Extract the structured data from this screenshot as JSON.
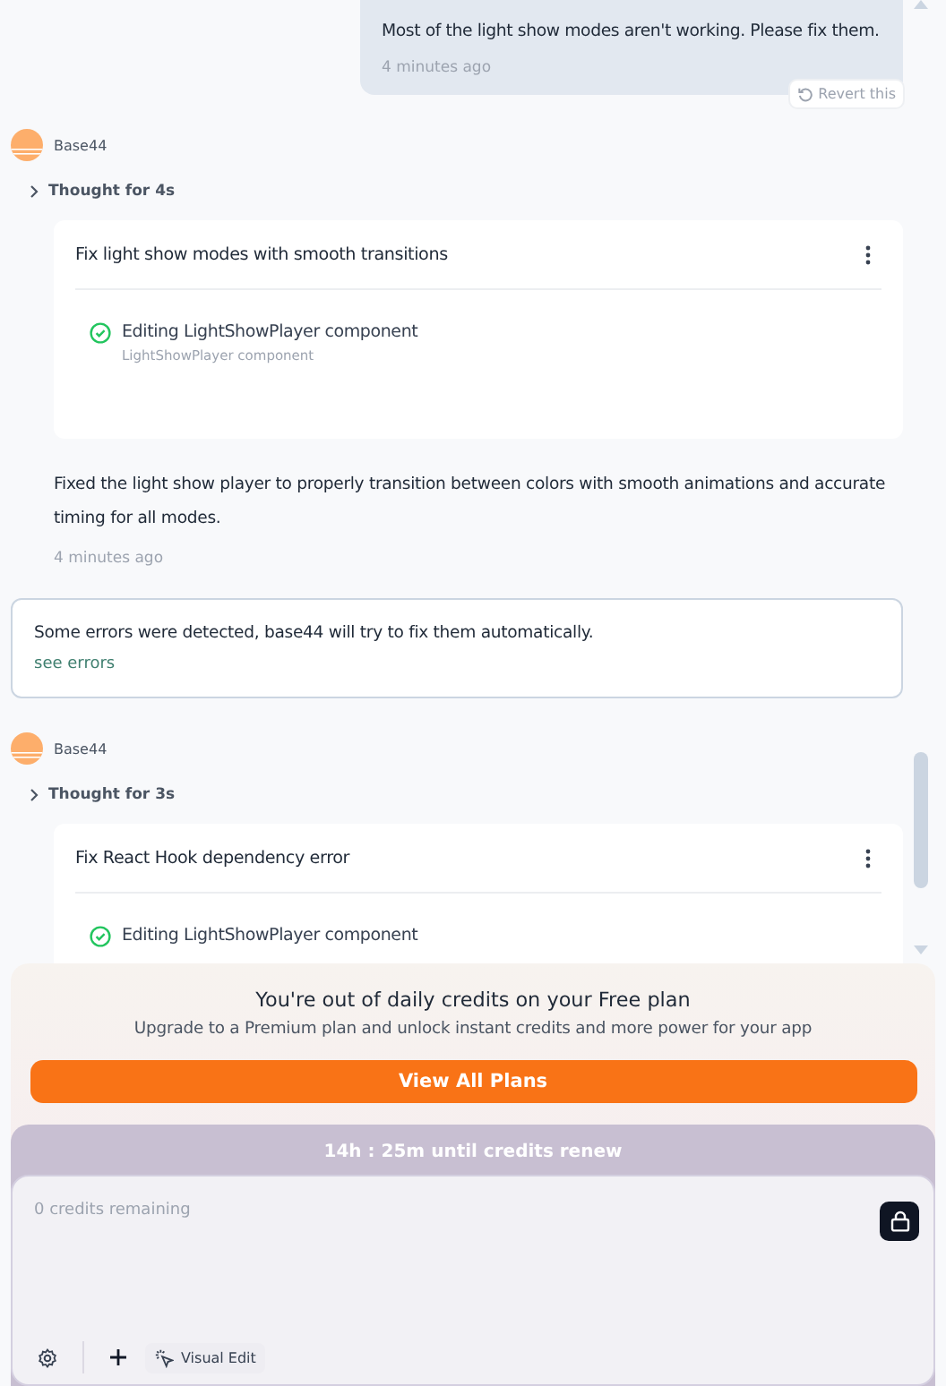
{
  "user_message": {
    "text": "Most of the light show modes aren't working. Please fix them.",
    "time": "4 minutes ago",
    "revert_label": "Revert this"
  },
  "turns": [
    {
      "author": "Base44",
      "thought": "Thought for 4s",
      "card": {
        "title": "Fix light show modes with smooth transitions",
        "steps": [
          {
            "label": "Editing LightShowPlayer component",
            "detail": "LightShowPlayer component",
            "done": true
          }
        ]
      },
      "reply": "Fixed the light show player to properly transition between colors with smooth animations and accurate timing for all modes.",
      "time": "4 minutes ago",
      "notice": {
        "text": "Some errors were detected, base44 will try to fix them automatically.",
        "link": "see errors"
      }
    },
    {
      "author": "Base44",
      "thought": "Thought for 3s",
      "card": {
        "title": "Fix React Hook dependency error",
        "steps": [
          {
            "label": "Editing LightShowPlayer component",
            "done": true
          }
        ]
      }
    }
  ],
  "upgrade": {
    "title": "You're out of daily credits on your Free plan",
    "subtitle": "Upgrade to a Premium plan and unlock instant credits and more power for your app",
    "button": "View All Plans",
    "renew": "14h : 25m until credits renew"
  },
  "composer": {
    "placeholder": "0 credits remaining",
    "locked": true,
    "visual_edit": "Visual Edit"
  }
}
